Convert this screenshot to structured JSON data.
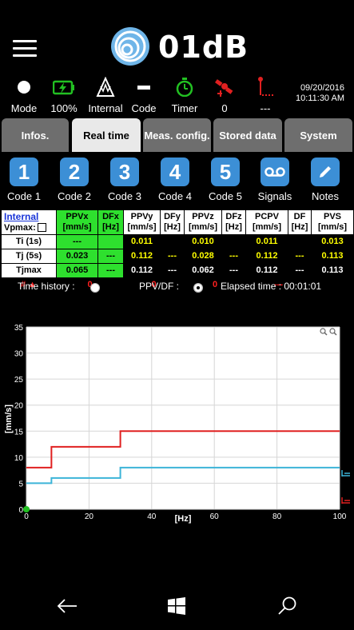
{
  "header": {
    "brand": "01dB"
  },
  "status": [
    {
      "icon": "mode-icon",
      "label": "Mode"
    },
    {
      "icon": "battery-charging-icon",
      "label": "100%"
    },
    {
      "icon": "internal-sensor-icon",
      "label": "Internal"
    },
    {
      "icon": "code-dash-icon",
      "label": "Code"
    },
    {
      "icon": "timer-icon",
      "label": "Timer"
    },
    {
      "icon": "satellite-icon",
      "label": "0"
    },
    {
      "icon": "trigger-icon",
      "label": "---"
    }
  ],
  "datetime": {
    "date": "09/20/2016",
    "time": "10:11:30 AM"
  },
  "tabs": [
    {
      "label": "Infos."
    },
    {
      "label": "Real time"
    },
    {
      "label": "Meas. config."
    },
    {
      "label": "Stored data"
    },
    {
      "label": "System"
    }
  ],
  "codes": [
    {
      "symbol": "1",
      "label": "Code 1"
    },
    {
      "symbol": "2",
      "label": "Code 2"
    },
    {
      "symbol": "3",
      "label": "Code 3"
    },
    {
      "symbol": "4",
      "label": "Code 4"
    },
    {
      "symbol": "5",
      "label": "Code 5"
    },
    {
      "symbol": "",
      "label": "Signals"
    },
    {
      "symbol": "",
      "label": "Notes"
    }
  ],
  "table": {
    "internal": "Internal",
    "vpmax": "Vpmax:",
    "headers": [
      {
        "l1": "PPVx",
        "l2": "[mm/s]"
      },
      {
        "l1": "DFx",
        "l2": "[Hz]"
      },
      {
        "l1": "PPVy",
        "l2": "[mm/s]"
      },
      {
        "l1": "DFy",
        "l2": "[Hz]"
      },
      {
        "l1": "PPVz",
        "l2": "[mm/s]"
      },
      {
        "l1": "DFz",
        "l2": "[Hz]"
      },
      {
        "l1": "PCPV",
        "l2": "[mm/s]"
      },
      {
        "l1": "DF",
        "l2": "[Hz]"
      },
      {
        "l1": "PVS",
        "l2": "[mm/s]"
      }
    ],
    "rows": [
      {
        "label": "Ti (1s)",
        "cells": [
          "---",
          "",
          "0.011",
          "",
          "0.010",
          "",
          "0.011",
          "",
          "0.013"
        ]
      },
      {
        "label": "Tj (5s)",
        "cells": [
          "0.023",
          "---",
          "0.112",
          "---",
          "0.028",
          "---",
          "0.112",
          "---",
          "0.113"
        ]
      },
      {
        "label": "Tjmax",
        "cells": [
          "0.065",
          "---",
          "0.112",
          "---",
          "0.062",
          "---",
          "0.112",
          "---",
          "0.113"
        ]
      }
    ],
    "count_label": "# ▲",
    "counts": [
      "0",
      "0",
      "0",
      "---"
    ]
  },
  "chart_bar": {
    "time_history": "Time history :",
    "ppv_df": "PPV/DF :",
    "elapsed": "Elapsed time : 00:01:01"
  },
  "chart_data": {
    "type": "line",
    "xlabel": "[Hz]",
    "ylabel": "[mm/s]",
    "xlim": [
      0,
      100
    ],
    "ylim": [
      0,
      35
    ],
    "xticks": [
      "0",
      "20",
      "40",
      "60",
      "80",
      "100"
    ],
    "yticks": [
      "0",
      "5",
      "10",
      "15",
      "20",
      "25",
      "30",
      "35"
    ],
    "grid": true,
    "series": [
      {
        "color": "#e02020",
        "x": [
          0,
          8,
          8,
          30,
          30,
          100
        ],
        "y": [
          8,
          8,
          12,
          12,
          15,
          15
        ]
      },
      {
        "color": "#3cb4d8",
        "x": [
          0,
          8,
          8,
          30,
          30,
          100
        ],
        "y": [
          5,
          5,
          6,
          6,
          8,
          8
        ]
      }
    ]
  },
  "colors": {
    "accent": "#3c8fd6",
    "green": "#2ee02e",
    "warning": "#ff2020",
    "yellow": "#ffff00"
  }
}
